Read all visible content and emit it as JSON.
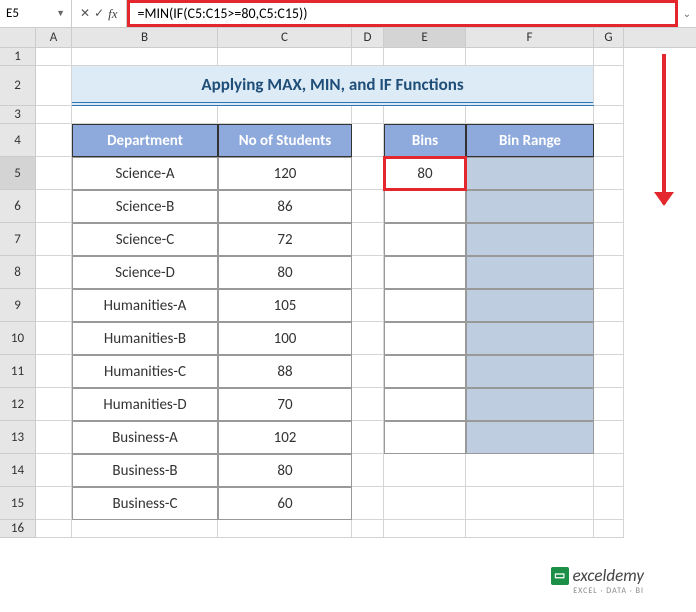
{
  "formula_bar": {
    "name_box": "E5",
    "formula": "=MIN(IF(C5:C15>=80,C5:C15))"
  },
  "columns": [
    "A",
    "B",
    "C",
    "D",
    "E",
    "F",
    "G"
  ],
  "title": "Applying MAX, MIN, and IF Functions",
  "headers": {
    "department": "Department",
    "no_students": "No of Students",
    "bins": "Bins",
    "bin_range": "Bin Range"
  },
  "table": [
    {
      "dept": "Science-A",
      "val": "120"
    },
    {
      "dept": "Science-B",
      "val": "86"
    },
    {
      "dept": "Science-C",
      "val": "72"
    },
    {
      "dept": "Science-D",
      "val": "80"
    },
    {
      "dept": "Humanities-A",
      "val": "105"
    },
    {
      "dept": "Humanities-B",
      "val": "100"
    },
    {
      "dept": "Humanities-C",
      "val": "88"
    },
    {
      "dept": "Humanities-D",
      "val": "70"
    },
    {
      "dept": "Business-A",
      "val": "102"
    },
    {
      "dept": "Business-B",
      "val": "80"
    },
    {
      "dept": "Business-C",
      "val": "60"
    }
  ],
  "bins_value": "80",
  "logo": {
    "text": "exceldemy",
    "sub": "EXCEL · DATA · BI"
  }
}
